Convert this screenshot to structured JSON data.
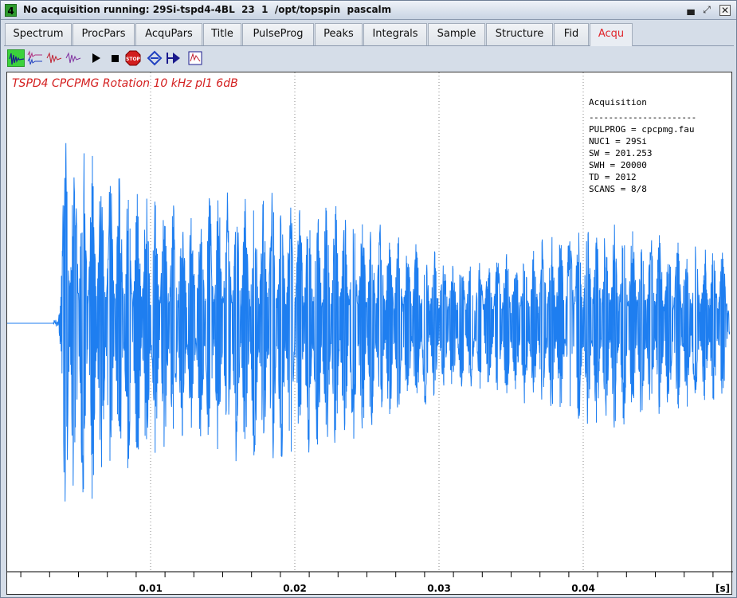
{
  "window": {
    "number": "4",
    "title": "No acquisition running: 29Si-tspd4-4BL  23  1  /opt/topspin  pascalm"
  },
  "tabs": [
    {
      "label": "Spectrum"
    },
    {
      "label": "ProcPars"
    },
    {
      "label": "AcquPars"
    },
    {
      "label": "Title"
    },
    {
      "label": "PulseProg"
    },
    {
      "label": "Peaks"
    },
    {
      "label": "Integrals"
    },
    {
      "label": "Sample"
    },
    {
      "label": "Structure"
    },
    {
      "label": "Fid"
    },
    {
      "label": "Acqu",
      "active": true
    }
  ],
  "toolbar": {
    "icons": [
      "fid-display-icon",
      "multi-fid-icon",
      "fid-red-icon",
      "fid-purple-icon",
      "play-icon",
      "stop-icon",
      "stop-sign-icon",
      "lock-icon",
      "tune-icon",
      "window-icon"
    ]
  },
  "plot": {
    "title": "TSPD4 CPCPMG Rotation 10 kHz pl1 6dB",
    "line_color": "#1e7ef0",
    "acquisition": {
      "heading": "Acquisition",
      "separator": "----------------------",
      "lines": [
        "PULPROG = cpcpmg.fau",
        "NUC1 = 29Si",
        "SW = 201.253",
        "SWH = 20000",
        "TD = 2012",
        "SCANS = 8/8"
      ]
    },
    "x_axis": {
      "ticks": [
        "0.01",
        "0.02",
        "0.03",
        "0.04"
      ],
      "unit": "[s]"
    }
  }
}
